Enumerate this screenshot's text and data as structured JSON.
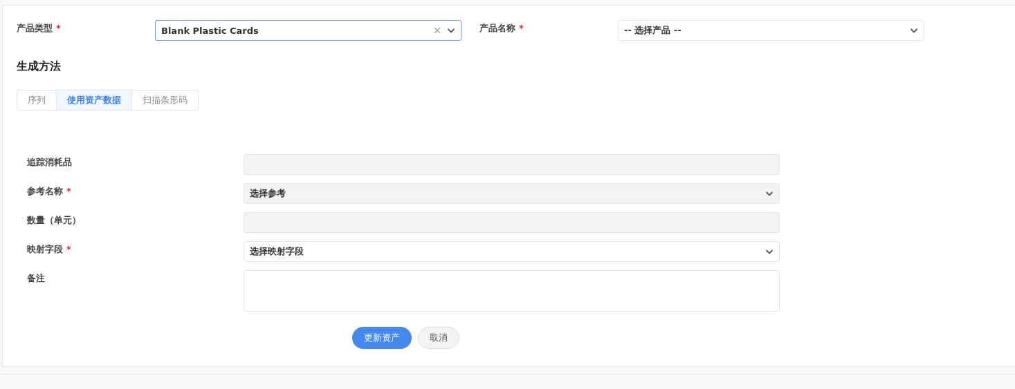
{
  "top_fields": [
    {
      "label": "产品类型",
      "required_mark": "*",
      "value": "Blank Plastic Cards",
      "focused": true,
      "clearable": true
    },
    {
      "label": "产品名称",
      "required_mark": "*",
      "value": "-- 选择产品 --",
      "focused": false,
      "clearable": false
    }
  ],
  "section_title": "生成方法",
  "tabs": [
    {
      "label": "序列",
      "selected": false
    },
    {
      "label": "使用资产数据",
      "selected": true
    },
    {
      "label": "扫描条形码",
      "selected": false
    }
  ],
  "form_rows": [
    {
      "kind": "input",
      "label": "追踪消耗品",
      "disabled": true
    },
    {
      "kind": "select",
      "label": "参考名称",
      "required_mark": "*",
      "disabled": true,
      "value": "选择参考"
    },
    {
      "kind": "input",
      "label": "数量（单元）",
      "disabled": true
    },
    {
      "kind": "select",
      "label": "映射字段",
      "required_mark": "*",
      "disabled": false,
      "value": "选择映射字段"
    },
    {
      "kind": "textarea",
      "label": "备注",
      "disabled": false
    }
  ],
  "buttons": [
    {
      "label": "更新资产",
      "kind": "primary"
    },
    {
      "label": "取消",
      "kind": "secondary"
    }
  ]
}
